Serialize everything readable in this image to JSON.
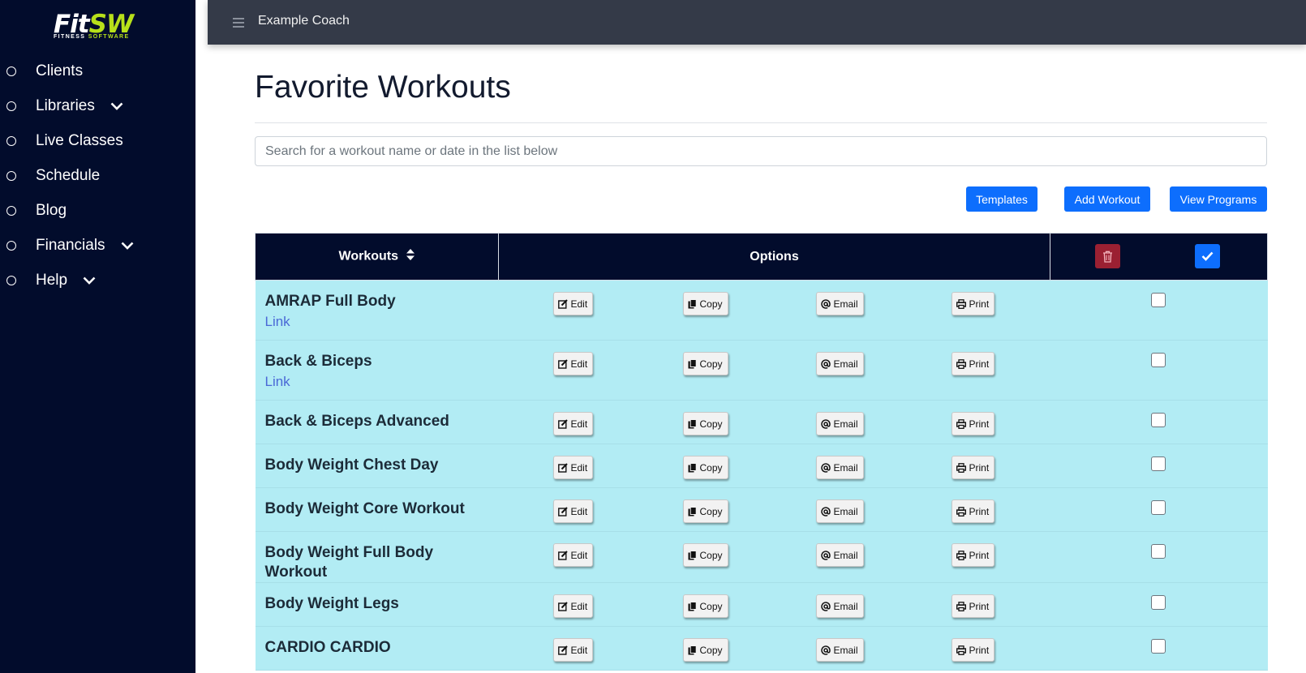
{
  "logo": {
    "brand_a": "Fit",
    "brand_b": "SW",
    "tag_a": "FITNESS ",
    "tag_b": "SOFTWARE"
  },
  "sidebar": {
    "items": [
      {
        "label": "Clients",
        "chevron": false
      },
      {
        "label": "Libraries",
        "chevron": true
      },
      {
        "label": "Live Classes",
        "chevron": false
      },
      {
        "label": "Schedule",
        "chevron": false
      },
      {
        "label": "Blog",
        "chevron": false
      },
      {
        "label": "Financials",
        "chevron": true
      },
      {
        "label": "Help",
        "chevron": true
      }
    ]
  },
  "topbar": {
    "coach_name": "Example Coach"
  },
  "page": {
    "title": "Favorite Workouts",
    "search_placeholder": "Search for a workout name or date in the list below",
    "buttons": {
      "templates": "Templates",
      "add_workout": "Add Workout",
      "view_programs": "View Programs"
    }
  },
  "table": {
    "headers": {
      "workouts": "Workouts",
      "options": "Options"
    },
    "option_labels": {
      "edit": "Edit",
      "copy": "Copy",
      "email": "Email",
      "print": "Print"
    },
    "rows": [
      {
        "name": "AMRAP Full Body",
        "link": "Link",
        "checked": false
      },
      {
        "name": "Back & Biceps",
        "link": "Link",
        "checked": false
      },
      {
        "name": "Back & Biceps Advanced",
        "link": null,
        "checked": false
      },
      {
        "name": "Body Weight Chest Day",
        "link": null,
        "checked": false
      },
      {
        "name": "Body Weight Core Workout",
        "link": null,
        "checked": false
      },
      {
        "name": "Body Weight Full Body Workout",
        "link": null,
        "checked": false
      },
      {
        "name": "Body Weight Legs",
        "link": null,
        "checked": false
      },
      {
        "name": "CARDIO CARDIO",
        "link": null,
        "checked": false
      }
    ]
  },
  "colors": {
    "sidebar_bg": "#020c2c",
    "topbar_bg": "#343a48",
    "primary": "#0d6efd",
    "danger": "#9b2032",
    "row_bg": "#b2ecf4",
    "brand_green": "#b7e01a"
  },
  "icons": {
    "nav": "circle-bullet-icon",
    "expand": "chevron-down-icon",
    "menu": "hamburger-menu-icon",
    "sort": "sort-icon",
    "delete": "trash-icon",
    "select_all": "check-icon",
    "edit": "edit-icon",
    "copy": "copy-icon",
    "email": "at-sign-icon",
    "print": "printer-icon"
  }
}
